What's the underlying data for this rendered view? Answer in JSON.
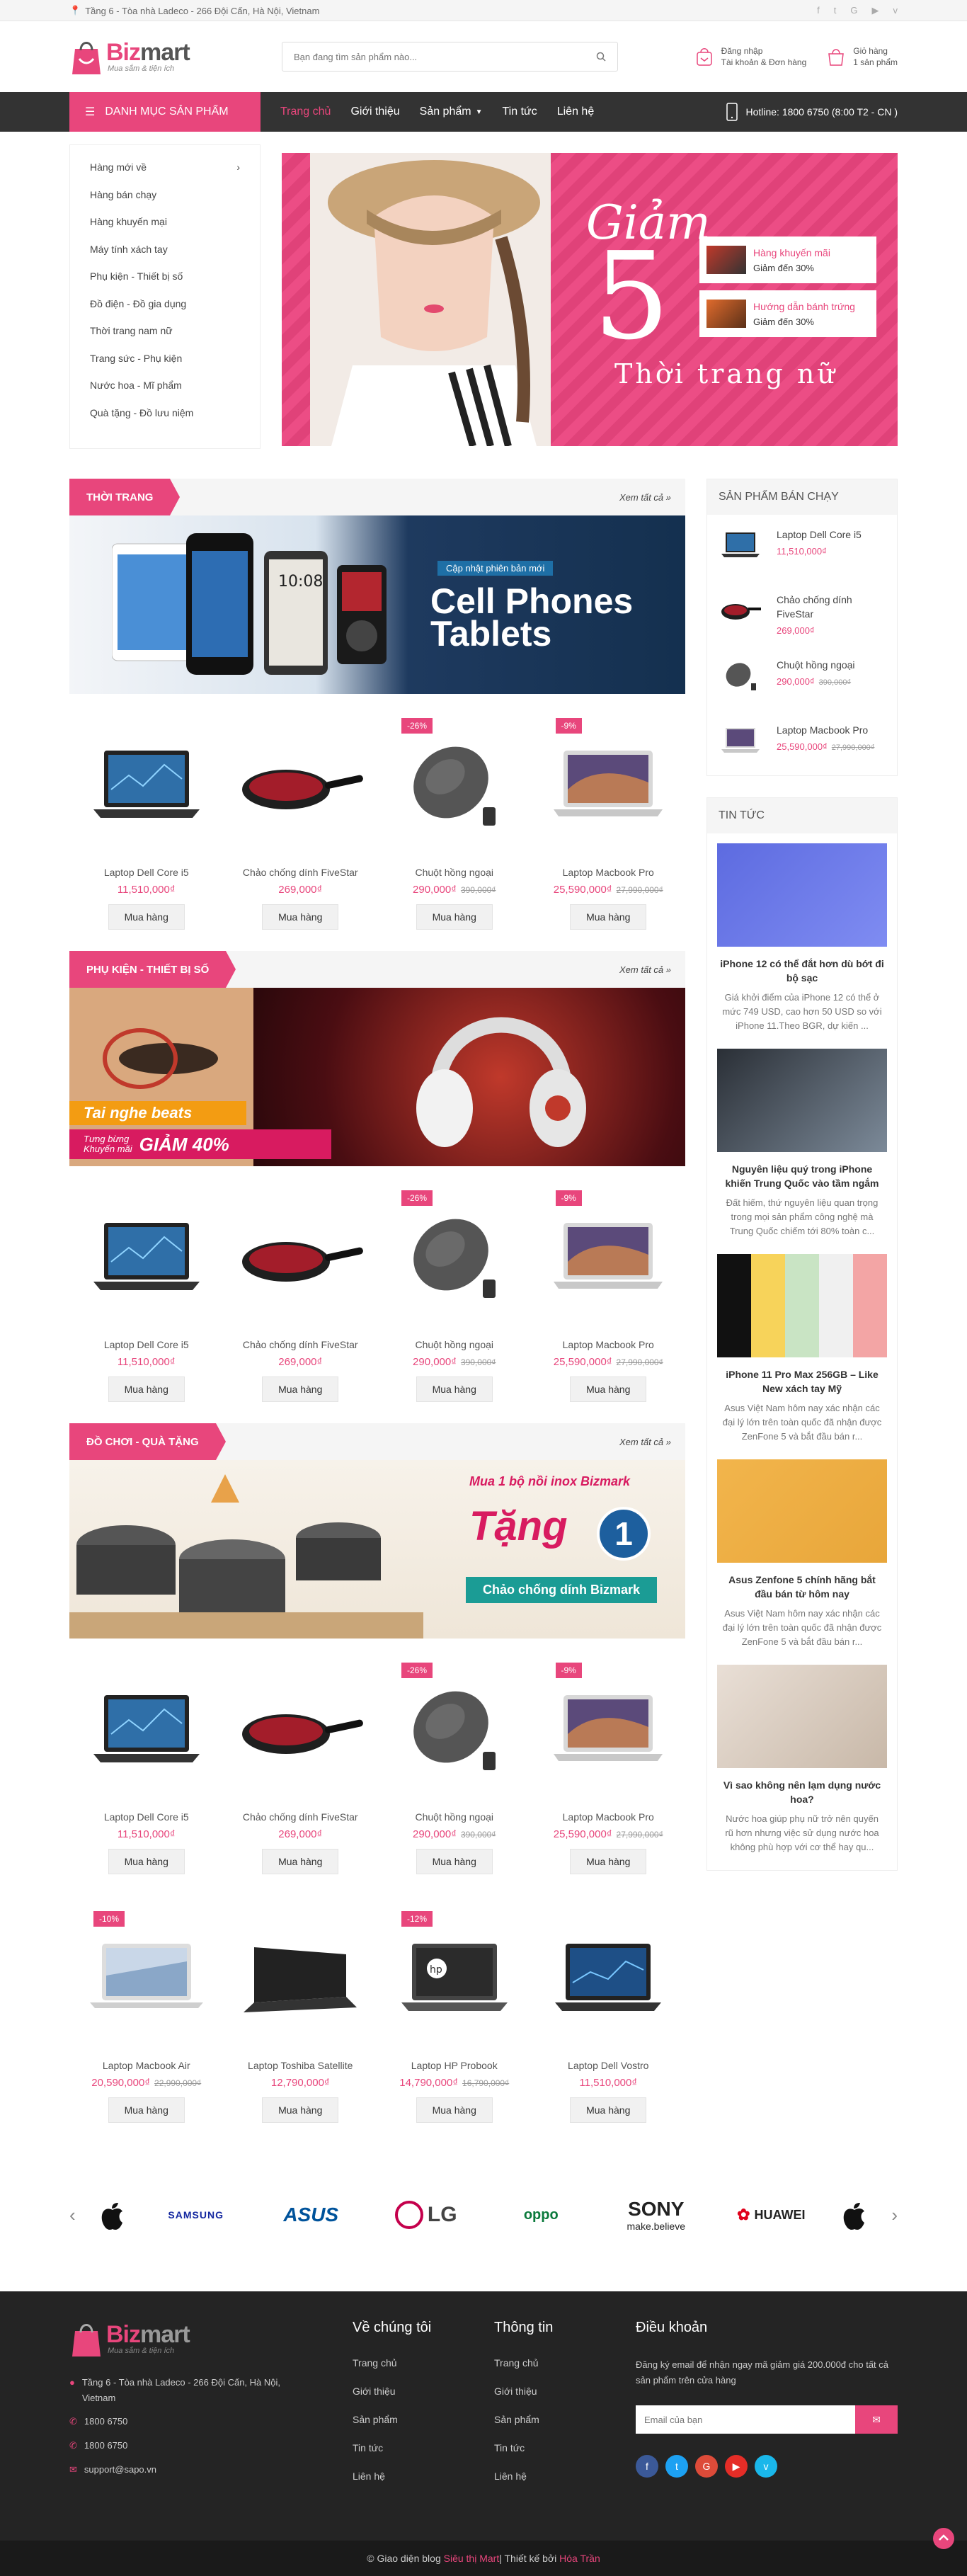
{
  "topbar": {
    "address": "Tầng 6 - Tòa nhà Ladeco - 266 Đội Cấn, Hà Nội, Vietnam",
    "socials": [
      "facebook-icon",
      "twitter-icon",
      "google-plus-icon",
      "youtube-icon",
      "vimeo-icon"
    ]
  },
  "header": {
    "logo_main": "Biz",
    "logo_accent": "mart",
    "logo_tagline": "Mua sắm & tiện ích",
    "search_placeholder": "Bạn đang tìm sản phẩm nào...",
    "login_label": "Đăng nhập",
    "account_label": "Tài khoản & Đơn hàng",
    "cart_label": "Giỏ hàng",
    "cart_count": "1 sản phẩm"
  },
  "nav": {
    "category_button": "Danh mục sản phẩm",
    "menu": [
      "Trang chủ",
      "Giới thiệu",
      "Sản phẩm",
      "Tin tức",
      "Liên hệ"
    ],
    "hotline": "Hotline: 1800 6750 (8:00 T2 - CN )"
  },
  "categories": [
    "Hàng mới về",
    "Hàng bán chạy",
    "Hàng khuyến mại",
    "Máy tính xách tay",
    "Phụ kiện - Thiết bị số",
    "Đồ điện - Đồ gia dụng",
    "Thời trang nam nữ",
    "Trang sức - Phụ kiện",
    "Nước hoa - Mĩ phẩm",
    "Quà tặng - Đồ lưu niệm"
  ],
  "hero": {
    "title_script": "Giảm",
    "big_number": "5",
    "subtitle": "Thời trang nữ",
    "promos": [
      {
        "title": "Hàng khuyến mãi",
        "desc": "Giảm đến 30%"
      },
      {
        "title": "Hướng dẫn bánh trứng",
        "desc": "Giảm đến 30%"
      }
    ]
  },
  "sections": [
    {
      "title": "Thời trang",
      "see_all": "Xem tất cả",
      "banner_tag": "Cập nhật phiên bản mới",
      "banner_line1": "Cell Phones",
      "banner_line2": "Tablets"
    },
    {
      "title": "Phụ kiện - Thiết bị số",
      "see_all": "Xem tất cả",
      "banner_tag": "Tai nghe beats",
      "banner_line1": "Tưng bừng",
      "banner_line2": "Khuyến mãi",
      "banner_deal": "GIẢM 40%"
    },
    {
      "title": "Đồ chơi - Quà tặng",
      "see_all": "Xem tất cả",
      "banner_tag": "Mua 1 bộ nồi inox Bizmark",
      "banner_line1": "Tặng",
      "banner_line2": "1",
      "banner_deal": "Chảo chống dính Bizmark"
    }
  ],
  "products": [
    {
      "name": "Laptop Dell Core i5",
      "price": "11,510,000₫",
      "old": "",
      "badge": ""
    },
    {
      "name": "Chảo chống dính FiveStar",
      "price": "269,000₫",
      "old": "",
      "badge": ""
    },
    {
      "name": "Chuột hồng ngoại",
      "price": "290,000₫",
      "old": "390,000₫",
      "badge": "-26%"
    },
    {
      "name": "Laptop Macbook Pro",
      "price": "25,590,000₫",
      "old": "27,990,000₫",
      "badge": "-9%"
    }
  ],
  "extra_products": [
    {
      "name": "Laptop Macbook Air",
      "price": "20,590,000₫",
      "old": "22,990,000₫",
      "badge": "-10%"
    },
    {
      "name": "Laptop Toshiba Satellite",
      "price": "12,790,000₫",
      "old": "",
      "badge": ""
    },
    {
      "name": "Laptop HP Probook",
      "price": "14,790,000₫",
      "old": "16,790,000₫",
      "badge": "-12%"
    },
    {
      "name": "Laptop Dell Vostro",
      "price": "11,510,000₫",
      "old": "",
      "badge": ""
    }
  ],
  "buy_label": "Mua hàng",
  "bestsellers": {
    "title": "Sản phẩm bán chạy",
    "items": [
      {
        "name": "Laptop Dell Core i5",
        "price": "11,510,000₫",
        "old": ""
      },
      {
        "name": "Chảo chống dính FiveStar",
        "price": "269,000₫",
        "old": ""
      },
      {
        "name": "Chuột hồng ngoại",
        "price": "290,000₫",
        "old": "390,000₫"
      },
      {
        "name": "Laptop Macbook Pro",
        "price": "25,590,000₫",
        "old": "27,990,000₫"
      }
    ]
  },
  "news": {
    "title": "Tin tức",
    "items": [
      {
        "title": "iPhone 12 có thể đắt hơn dù bớt đi bộ sạc",
        "desc": "Giá khởi điểm của iPhone 12 có thể ở mức 749 USD, cao hơn 50 USD so với iPhone 11.Theo BGR, dự kiến ..."
      },
      {
        "title": "Nguyên liệu quý trong iPhone khiến Trung Quốc vào tầm ngắm",
        "desc": "Đất hiếm, thứ nguyên liệu quan trọng trong mọi sản phẩm công nghệ mà Trung Quốc chiếm tới 80% toàn c..."
      },
      {
        "title": "iPhone 11 Pro Max 256GB – Like New xách tay Mỹ",
        "desc": "Asus Việt Nam hôm nay xác nhận các đại lý lớn trên toàn quốc đã nhận được ZenFone 5 và bắt đầu bán r..."
      },
      {
        "title": "Asus Zenfone 5 chính hãng bắt đầu bán từ hôm nay",
        "desc": "Asus Việt Nam hôm nay xác nhận các đại lý lớn trên toàn quốc đã nhận được ZenFone 5 và bắt đầu bán r..."
      },
      {
        "title": "Vì sao không nên lạm dụng nước hoa?",
        "desc": "Nước hoa giúp phụ nữ trở nên quyến rũ hơn nhưng việc sử dụng nước hoa không phù hợp với cơ thể hay qu..."
      }
    ]
  },
  "brands": [
    "SAMSUNG",
    "ASUS",
    "LG",
    "oppo",
    "SONY",
    "HUAWEI"
  ],
  "brand_sony_sub": "make.believe",
  "footer": {
    "address": "Tầng 6 - Tòa nhà Ladeco - 266 Đội Cấn, Hà Nội, Vietnam",
    "phone1": "1800 6750",
    "phone2": "1800 6750",
    "email": "support@sapo.vn",
    "col1_title": "Về chúng tôi",
    "col2_title": "Thông tin",
    "col3_title": "Điều khoản",
    "links": [
      "Trang chủ",
      "Giới thiệu",
      "Sản phẩm",
      "Tin tức",
      "Liên hệ"
    ],
    "newsletter_text": "Đăng ký email để nhận ngay mã giảm giá 200.000đ cho tất cả sản phẩm trên cửa hàng",
    "email_placeholder": "Email của bạn",
    "copyright_prefix": "© Giao diện blog ",
    "copyright_brand": "Siêu thị Mart",
    "copyright_mid": " | Thiết kế bởi ",
    "copyright_author": "Hóa Trần"
  },
  "colors": {
    "accent": "#e8467c",
    "nav": "#333333",
    "footer": "#242424"
  }
}
